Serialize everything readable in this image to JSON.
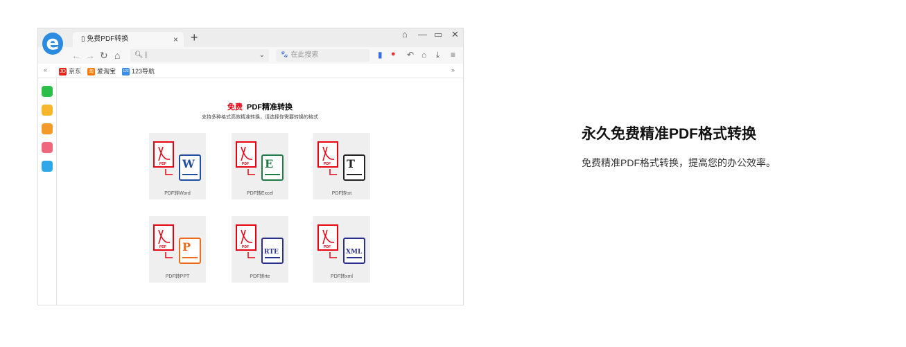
{
  "browser": {
    "tab_title": "免费PDF转换",
    "search_placeholder": "在此搜索",
    "bookmarks": [
      {
        "badge": "JD",
        "label": "京东",
        "color": "#e1251b"
      },
      {
        "badge": "淘",
        "label": "爱淘宝",
        "color": "#ff7a00"
      },
      {
        "badge": "123",
        "label": "123导航",
        "color": "#3b8ee8"
      }
    ]
  },
  "page": {
    "title_highlight": "免费",
    "title": "PDF精准转换",
    "subtitle": "支持多种格式高效精准转换，请选择你需要转换的格式",
    "cards": [
      {
        "label": "PDF转Word",
        "letter": "W",
        "color": "#1f4ea1"
      },
      {
        "label": "PDF转Excel",
        "letter": "E",
        "color": "#1e7b45"
      },
      {
        "label": "PDF转txt",
        "letter": "T",
        "color": "#222222"
      },
      {
        "label": "PDF转PPT",
        "letter": "P",
        "color": "#ec6a1a"
      },
      {
        "label": "PDF转rte",
        "letter": "RTE",
        "color": "#2b2f8f"
      },
      {
        "label": "PDF转xml",
        "letter": "XML",
        "color": "#2b2f8f"
      }
    ]
  },
  "promo": {
    "title": "永久免费精准PDF格式转换",
    "desc": "免费精准PDF格式转换，提高您的办公效率。"
  }
}
